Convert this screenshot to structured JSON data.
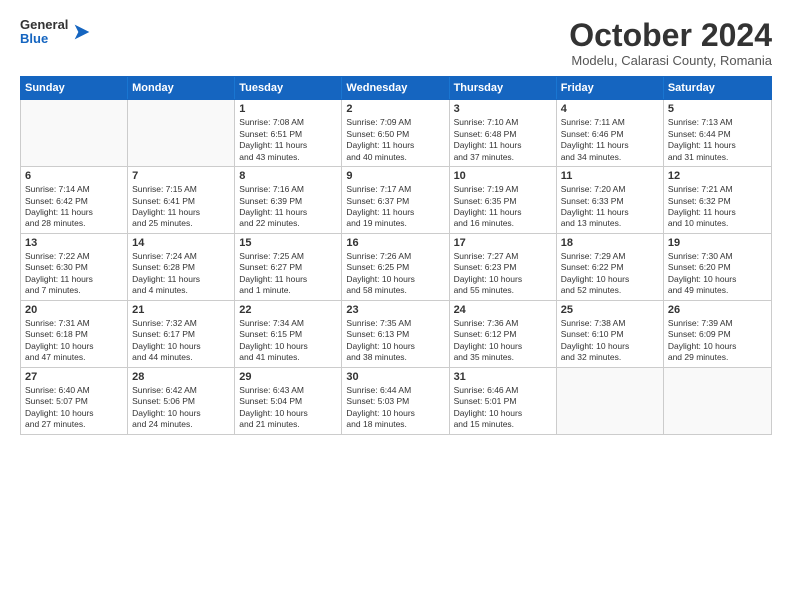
{
  "header": {
    "logo": {
      "general": "General",
      "blue": "Blue"
    },
    "title": "October 2024",
    "location": "Modelu, Calarasi County, Romania"
  },
  "days_of_week": [
    "Sunday",
    "Monday",
    "Tuesday",
    "Wednesday",
    "Thursday",
    "Friday",
    "Saturday"
  ],
  "weeks": [
    [
      {
        "day": "",
        "empty": true,
        "lines": []
      },
      {
        "day": "",
        "empty": true,
        "lines": []
      },
      {
        "day": "1",
        "lines": [
          "Sunrise: 7:08 AM",
          "Sunset: 6:51 PM",
          "Daylight: 11 hours",
          "and 43 minutes."
        ]
      },
      {
        "day": "2",
        "lines": [
          "Sunrise: 7:09 AM",
          "Sunset: 6:50 PM",
          "Daylight: 11 hours",
          "and 40 minutes."
        ]
      },
      {
        "day": "3",
        "lines": [
          "Sunrise: 7:10 AM",
          "Sunset: 6:48 PM",
          "Daylight: 11 hours",
          "and 37 minutes."
        ]
      },
      {
        "day": "4",
        "lines": [
          "Sunrise: 7:11 AM",
          "Sunset: 6:46 PM",
          "Daylight: 11 hours",
          "and 34 minutes."
        ]
      },
      {
        "day": "5",
        "lines": [
          "Sunrise: 7:13 AM",
          "Sunset: 6:44 PM",
          "Daylight: 11 hours",
          "and 31 minutes."
        ]
      }
    ],
    [
      {
        "day": "6",
        "lines": [
          "Sunrise: 7:14 AM",
          "Sunset: 6:42 PM",
          "Daylight: 11 hours",
          "and 28 minutes."
        ]
      },
      {
        "day": "7",
        "lines": [
          "Sunrise: 7:15 AM",
          "Sunset: 6:41 PM",
          "Daylight: 11 hours",
          "and 25 minutes."
        ]
      },
      {
        "day": "8",
        "lines": [
          "Sunrise: 7:16 AM",
          "Sunset: 6:39 PM",
          "Daylight: 11 hours",
          "and 22 minutes."
        ]
      },
      {
        "day": "9",
        "lines": [
          "Sunrise: 7:17 AM",
          "Sunset: 6:37 PM",
          "Daylight: 11 hours",
          "and 19 minutes."
        ]
      },
      {
        "day": "10",
        "lines": [
          "Sunrise: 7:19 AM",
          "Sunset: 6:35 PM",
          "Daylight: 11 hours",
          "and 16 minutes."
        ]
      },
      {
        "day": "11",
        "lines": [
          "Sunrise: 7:20 AM",
          "Sunset: 6:33 PM",
          "Daylight: 11 hours",
          "and 13 minutes."
        ]
      },
      {
        "day": "12",
        "lines": [
          "Sunrise: 7:21 AM",
          "Sunset: 6:32 PM",
          "Daylight: 11 hours",
          "and 10 minutes."
        ]
      }
    ],
    [
      {
        "day": "13",
        "lines": [
          "Sunrise: 7:22 AM",
          "Sunset: 6:30 PM",
          "Daylight: 11 hours",
          "and 7 minutes."
        ]
      },
      {
        "day": "14",
        "lines": [
          "Sunrise: 7:24 AM",
          "Sunset: 6:28 PM",
          "Daylight: 11 hours",
          "and 4 minutes."
        ]
      },
      {
        "day": "15",
        "lines": [
          "Sunrise: 7:25 AM",
          "Sunset: 6:27 PM",
          "Daylight: 11 hours",
          "and 1 minute."
        ]
      },
      {
        "day": "16",
        "lines": [
          "Sunrise: 7:26 AM",
          "Sunset: 6:25 PM",
          "Daylight: 10 hours",
          "and 58 minutes."
        ]
      },
      {
        "day": "17",
        "lines": [
          "Sunrise: 7:27 AM",
          "Sunset: 6:23 PM",
          "Daylight: 10 hours",
          "and 55 minutes."
        ]
      },
      {
        "day": "18",
        "lines": [
          "Sunrise: 7:29 AM",
          "Sunset: 6:22 PM",
          "Daylight: 10 hours",
          "and 52 minutes."
        ]
      },
      {
        "day": "19",
        "lines": [
          "Sunrise: 7:30 AM",
          "Sunset: 6:20 PM",
          "Daylight: 10 hours",
          "and 49 minutes."
        ]
      }
    ],
    [
      {
        "day": "20",
        "lines": [
          "Sunrise: 7:31 AM",
          "Sunset: 6:18 PM",
          "Daylight: 10 hours",
          "and 47 minutes."
        ]
      },
      {
        "day": "21",
        "lines": [
          "Sunrise: 7:32 AM",
          "Sunset: 6:17 PM",
          "Daylight: 10 hours",
          "and 44 minutes."
        ]
      },
      {
        "day": "22",
        "lines": [
          "Sunrise: 7:34 AM",
          "Sunset: 6:15 PM",
          "Daylight: 10 hours",
          "and 41 minutes."
        ]
      },
      {
        "day": "23",
        "lines": [
          "Sunrise: 7:35 AM",
          "Sunset: 6:13 PM",
          "Daylight: 10 hours",
          "and 38 minutes."
        ]
      },
      {
        "day": "24",
        "lines": [
          "Sunrise: 7:36 AM",
          "Sunset: 6:12 PM",
          "Daylight: 10 hours",
          "and 35 minutes."
        ]
      },
      {
        "day": "25",
        "lines": [
          "Sunrise: 7:38 AM",
          "Sunset: 6:10 PM",
          "Daylight: 10 hours",
          "and 32 minutes."
        ]
      },
      {
        "day": "26",
        "lines": [
          "Sunrise: 7:39 AM",
          "Sunset: 6:09 PM",
          "Daylight: 10 hours",
          "and 29 minutes."
        ]
      }
    ],
    [
      {
        "day": "27",
        "lines": [
          "Sunrise: 6:40 AM",
          "Sunset: 5:07 PM",
          "Daylight: 10 hours",
          "and 27 minutes."
        ]
      },
      {
        "day": "28",
        "lines": [
          "Sunrise: 6:42 AM",
          "Sunset: 5:06 PM",
          "Daylight: 10 hours",
          "and 24 minutes."
        ]
      },
      {
        "day": "29",
        "lines": [
          "Sunrise: 6:43 AM",
          "Sunset: 5:04 PM",
          "Daylight: 10 hours",
          "and 21 minutes."
        ]
      },
      {
        "day": "30",
        "lines": [
          "Sunrise: 6:44 AM",
          "Sunset: 5:03 PM",
          "Daylight: 10 hours",
          "and 18 minutes."
        ]
      },
      {
        "day": "31",
        "lines": [
          "Sunrise: 6:46 AM",
          "Sunset: 5:01 PM",
          "Daylight: 10 hours",
          "and 15 minutes."
        ]
      },
      {
        "day": "",
        "empty": true,
        "lines": []
      },
      {
        "day": "",
        "empty": true,
        "lines": []
      }
    ]
  ]
}
